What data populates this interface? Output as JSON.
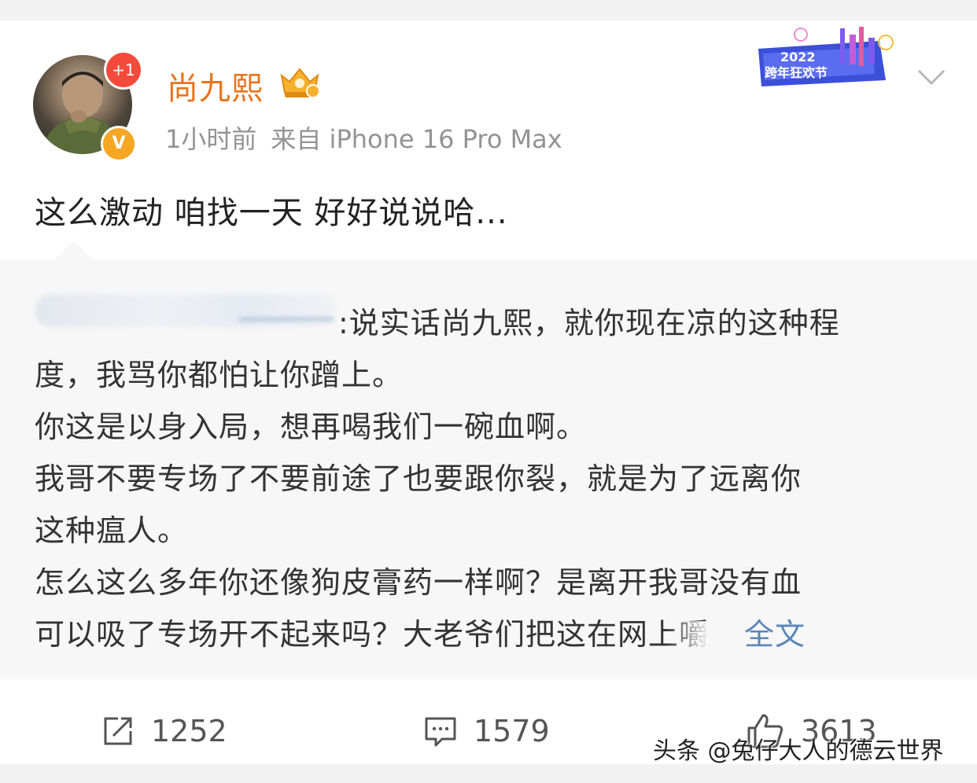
{
  "post": {
    "username": "尚九熙",
    "plus_badge": "+1",
    "verified_badge": "V",
    "time": "1小时前",
    "source": "来自 iPhone 16 Pro Max",
    "text": "这么激动 咱找一天 好好说说哈...",
    "banner_year": "2022",
    "banner_text": "跨年狂欢节"
  },
  "quoted": {
    "lines": [
      ":说实话尚九熙，就你现在凉的这种程",
      "度，我骂你都怕让你蹭上。",
      "你这是以身入局，想再喝我们一碗血啊。",
      "我哥不要专场了不要前途了也要跟你裂，就是为了远离你",
      "这种瘟人。",
      "怎么这么多年你还像狗皮膏药一样啊？是离开我哥没有血",
      "可以吸了专场开不起来吗？大老爷们把这在网上嚼"
    ],
    "fulltext_label": "全文"
  },
  "actions": {
    "repost_count": "1252",
    "comment_count": "1579",
    "like_count": "3613"
  },
  "watermark": "头条 @兔仔大人的德云世界",
  "colors": {
    "username": "#e8731b",
    "link": "#5b86b9",
    "badge_red": "#f34a3b",
    "badge_orange": "#f5a623"
  }
}
